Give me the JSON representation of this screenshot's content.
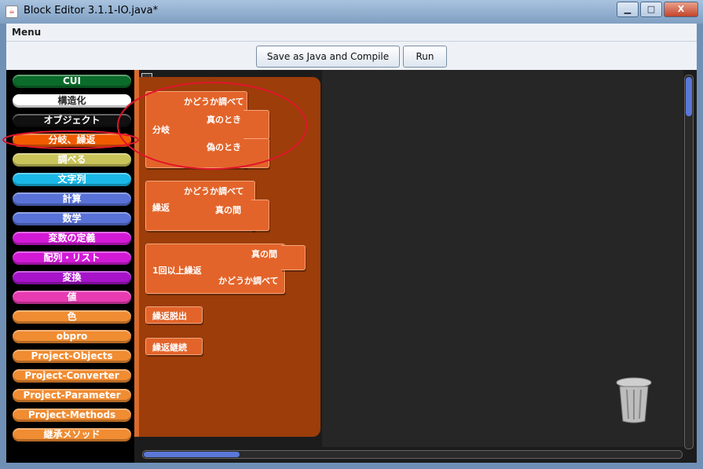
{
  "window": {
    "title": "Block Editor 3.1.1-IO.java*",
    "minimize": "▁",
    "maximize": "□",
    "close": "X"
  },
  "menubar": {
    "menu_label": "Menu"
  },
  "toolbar": {
    "save_label": "Save as Java and Compile",
    "run_label": "Run"
  },
  "palette": {
    "categories": [
      {
        "label": "CUI",
        "color": "#0b6b2a",
        "text_color": "#ffffff"
      },
      {
        "label": "構造化",
        "color": "#ffffff",
        "text_color": "#222222"
      },
      {
        "label": "オブジェクト",
        "color": "#111111",
        "text_color": "#ffffff"
      },
      {
        "label": "分岐、繰返",
        "color": "#f25c00",
        "text_color": "#ffffff"
      },
      {
        "label": "調べる",
        "color": "#c9c45a",
        "text_color": "#ffffff"
      },
      {
        "label": "文字列",
        "color": "#19b8e8",
        "text_color": "#ffffff"
      },
      {
        "label": "計算",
        "color": "#5872d8",
        "text_color": "#ffffff"
      },
      {
        "label": "数学",
        "color": "#5872d8",
        "text_color": "#ffffff"
      },
      {
        "label": "変数の定義",
        "color": "#d21ad6",
        "text_color": "#ffffff"
      },
      {
        "label": "配列・リスト",
        "color": "#d21ad6",
        "text_color": "#ffffff"
      },
      {
        "label": "変換",
        "color": "#a613c9",
        "text_color": "#ffffff"
      },
      {
        "label": "値",
        "color": "#e83bb2",
        "text_color": "#ffffff"
      },
      {
        "label": "色",
        "color": "#f08c32",
        "text_color": "#ffffff"
      },
      {
        "label": "obpro",
        "color": "#f08c32",
        "text_color": "#ffffff"
      },
      {
        "label": "Project-Objects",
        "color": "#f08c32",
        "text_color": "#ffffff"
      },
      {
        "label": "Project-Converter",
        "color": "#f08c32",
        "text_color": "#ffffff"
      },
      {
        "label": "Project-Parameter",
        "color": "#f08c32",
        "text_color": "#ffffff"
      },
      {
        "label": "Project-Methods",
        "color": "#f08c32",
        "text_color": "#ffffff"
      },
      {
        "label": "継承メソッド",
        "color": "#f08c32",
        "text_color": "#ffffff"
      }
    ],
    "selected_index": 3
  },
  "blocks": {
    "branch": {
      "name": "分岐",
      "cond": "かどうか調べて",
      "then": "真のとき",
      "else": "偽のとき"
    },
    "while": {
      "name": "繰返",
      "cond": "かどうか調べて",
      "body": "真の間"
    },
    "dowhile": {
      "name": "1回以上繰返",
      "body": "真の間",
      "cond": "かどうか調べて"
    },
    "break": {
      "name": "繰返脱出"
    },
    "continue": {
      "name": "繰返継続"
    }
  },
  "colors": {
    "block": "#e3642a",
    "drawer": "#9c3d0a",
    "highlight": "#e0152b",
    "scroll": "#5b78d8"
  },
  "icons": [
    "java-cup-icon",
    "trash-can-icon"
  ]
}
